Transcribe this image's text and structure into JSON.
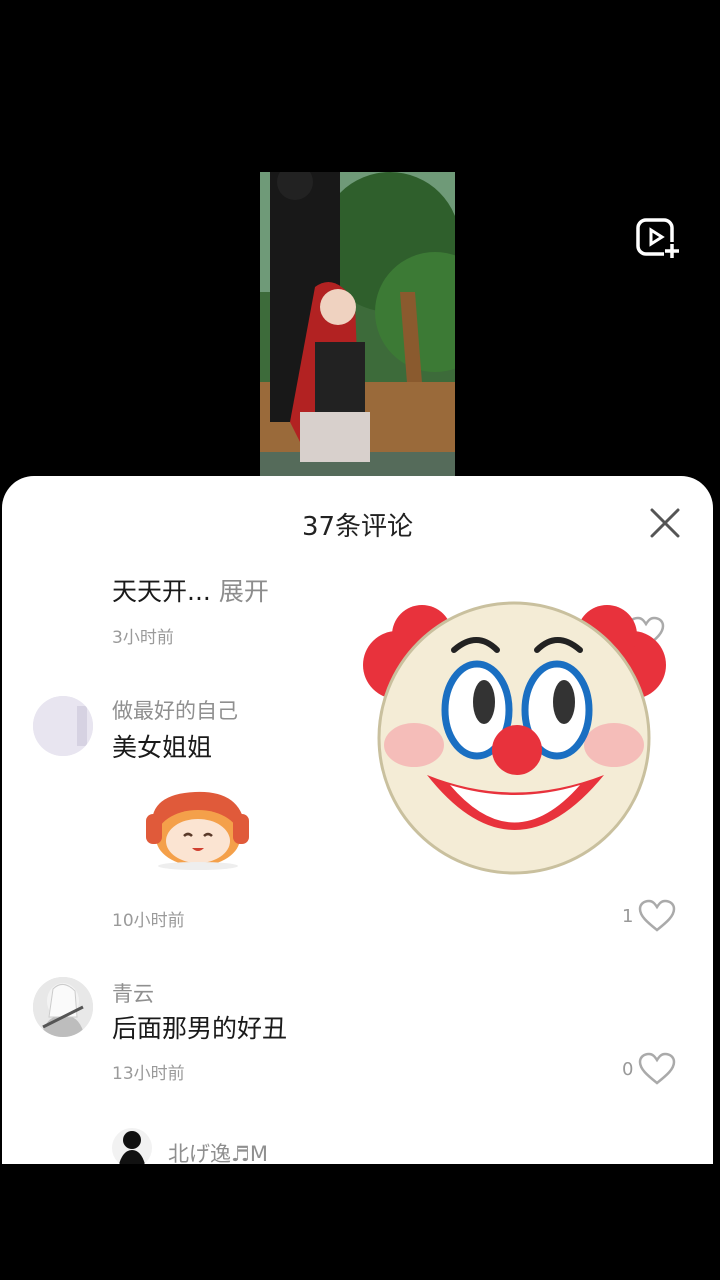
{
  "header": {
    "comment_count_title": "37条评论"
  },
  "comments": [
    {
      "text": "天天开...",
      "expand_label": "展开",
      "time": "3小时前",
      "likes": ""
    },
    {
      "username": "做最好的自己",
      "text": "美女姐姐",
      "time": "10小时前",
      "likes": "1"
    },
    {
      "username": "青云",
      "text": "后面那男的好丑",
      "time": "13小时前",
      "likes": "0"
    },
    {
      "username": "北げ逸♬M"
    }
  ],
  "icons": {
    "close": "close-icon",
    "like": "heart-outline-icon",
    "add_video": "add-video-icon",
    "clown": "clown-face-emoji"
  },
  "colors": {
    "sheet_bg": "#ffffff",
    "text_primary": "#1a1a1a",
    "text_secondary": "#9a9a9a"
  }
}
